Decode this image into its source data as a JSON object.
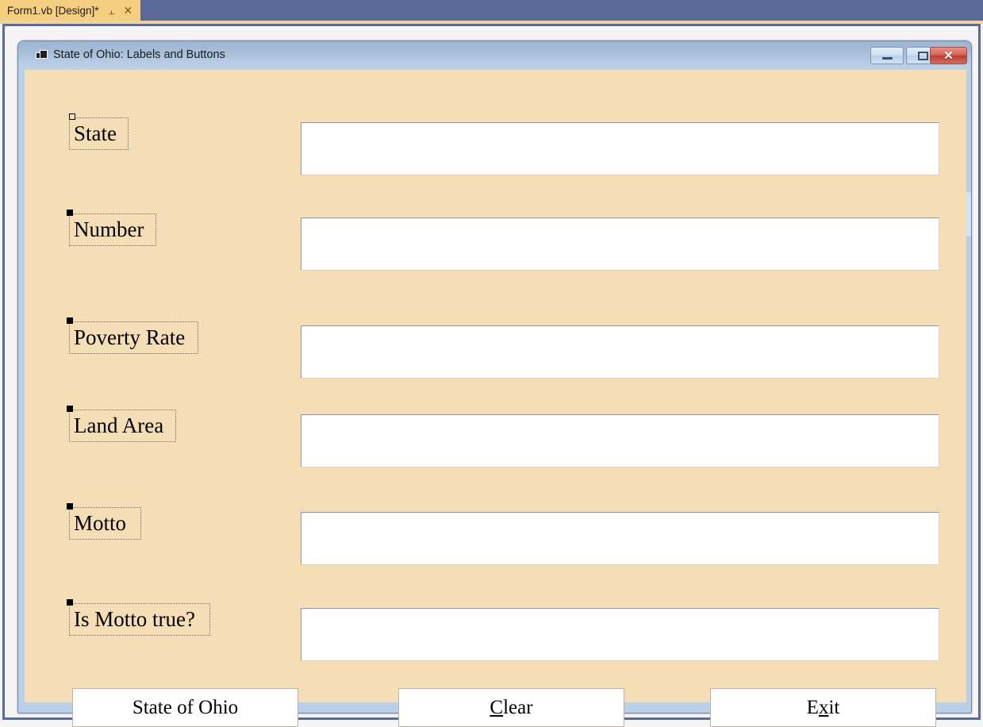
{
  "ide": {
    "tab": {
      "label": "Form1.vb [Design]*",
      "pin_icon": "⫠",
      "close_icon": "✕"
    }
  },
  "form": {
    "title": "State of Ohio: Labels and Buttons",
    "titlebar_color": "#a8c0d9",
    "client_color": "#f5deb6",
    "window_buttons": {
      "minimize": "minimize",
      "maximize": "maximize",
      "close": "✕"
    },
    "labels": [
      {
        "text": "State",
        "handle": "hollow"
      },
      {
        "text": "Number",
        "handle": "filled"
      },
      {
        "text": "Poverty Rate",
        "handle": "filled"
      },
      {
        "text": "Land Area",
        "handle": "filled"
      },
      {
        "text": "Motto",
        "handle": "filled"
      },
      {
        "text": "Is Motto true?",
        "handle": "filled"
      }
    ],
    "textboxes": [
      {
        "value": "",
        "placeholder": ""
      },
      {
        "value": "",
        "placeholder": ""
      },
      {
        "value": "",
        "placeholder": ""
      },
      {
        "value": "",
        "placeholder": ""
      },
      {
        "value": "",
        "placeholder": ""
      },
      {
        "value": "",
        "placeholder": ""
      }
    ],
    "buttons": [
      {
        "pre": "",
        "mnemonic": "",
        "post": "State of Ohio"
      },
      {
        "pre": "",
        "mnemonic": "C",
        "post": "lear"
      },
      {
        "pre": "E",
        "mnemonic": "x",
        "post": "it"
      }
    ]
  }
}
